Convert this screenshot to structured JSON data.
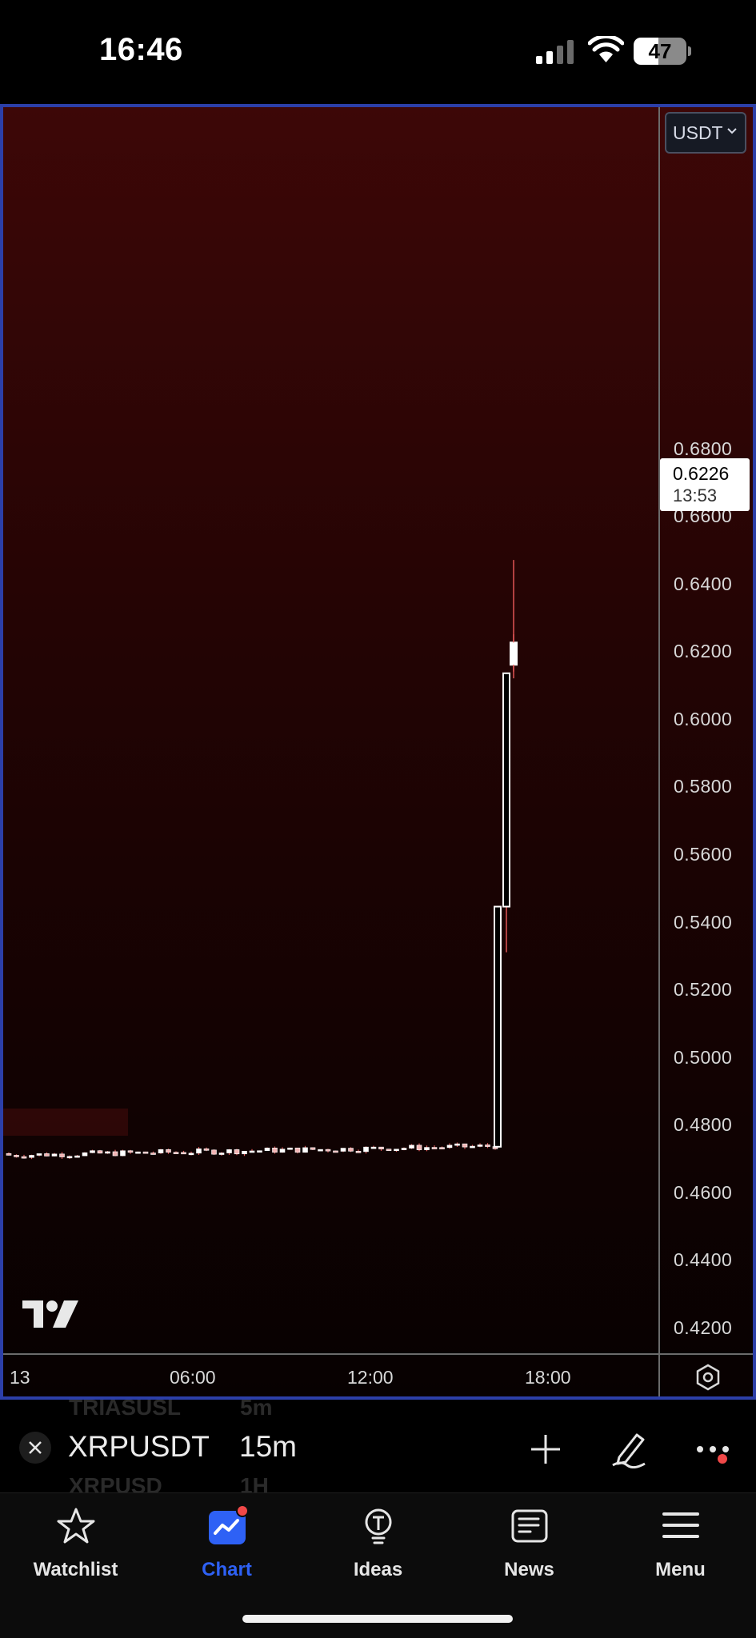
{
  "status_bar": {
    "time": "16:46",
    "battery_level": "47",
    "battery_fraction": 0.47,
    "icons": [
      "cellular-signal-icon",
      "wifi-icon",
      "battery-icon"
    ]
  },
  "chart": {
    "currency_selector": "USDT",
    "last_price": "0.6226",
    "countdown": "13:53",
    "price_ticks": [
      "0.6800",
      "0.6600",
      "0.6400",
      "0.6200",
      "0.6000",
      "0.5800",
      "0.5600",
      "0.5400",
      "0.5200",
      "0.5000",
      "0.4800",
      "0.4600",
      "0.4400",
      "0.4200"
    ],
    "time_ticks": [
      "13",
      "06:00",
      "12:00",
      "18:00"
    ],
    "logo": "tradingview-logo-icon",
    "colors": {
      "up": "#ffffff",
      "wick": "#e05555",
      "background_top": "#3d0707",
      "background_bottom": "#070101",
      "frame": "#2c3fa8"
    }
  },
  "chart_data": {
    "type": "candlestick",
    "symbol": "XRPUSDT",
    "interval": "15m",
    "ylim": [
      0.415,
      0.7
    ],
    "y_ticks": [
      0.68,
      0.66,
      0.64,
      0.62,
      0.6,
      0.58,
      0.56,
      0.54,
      0.52,
      0.5,
      0.48,
      0.46,
      0.44,
      0.42
    ],
    "x_ticks": [
      "13",
      "06:00",
      "12:00",
      "18:00"
    ],
    "baseline_range": {
      "from_time": "~00:00",
      "to_time": "~16:30",
      "low": 0.471,
      "high": 0.474
    },
    "breakout_candles": [
      {
        "time": "~16:30",
        "open": 0.4735,
        "high": 0.4735,
        "low": 0.4735,
        "close": 0.5445
      },
      {
        "time": "~16:45",
        "open": 0.5445,
        "high": 0.555,
        "low": 0.531,
        "close": 0.6135
      },
      {
        "time": "~17:00",
        "open": 0.6135,
        "high": 0.647,
        "low": 0.612,
        "close": 0.616
      },
      {
        "time": "~17:15",
        "open": 0.616,
        "high": 0.625,
        "low": 0.614,
        "close": 0.6226
      }
    ],
    "last_price": 0.6226
  },
  "symbol_bar": {
    "symbol": "XRPUSDT",
    "interval": "15m",
    "ghost_above_symbol": "TRIASUSL",
    "ghost_above_interval": "5m",
    "ghost_below_symbol": "XRPUSD",
    "ghost_below_interval": "1H"
  },
  "tabs": [
    {
      "label": "Watchlist",
      "icon": "star-icon",
      "active": false
    },
    {
      "label": "Chart",
      "icon": "chart-icon",
      "active": true
    },
    {
      "label": "Ideas",
      "icon": "lightbulb-icon",
      "active": false
    },
    {
      "label": "News",
      "icon": "newspaper-icon",
      "active": false
    },
    {
      "label": "Menu",
      "icon": "hamburger-menu-icon",
      "active": false
    }
  ]
}
